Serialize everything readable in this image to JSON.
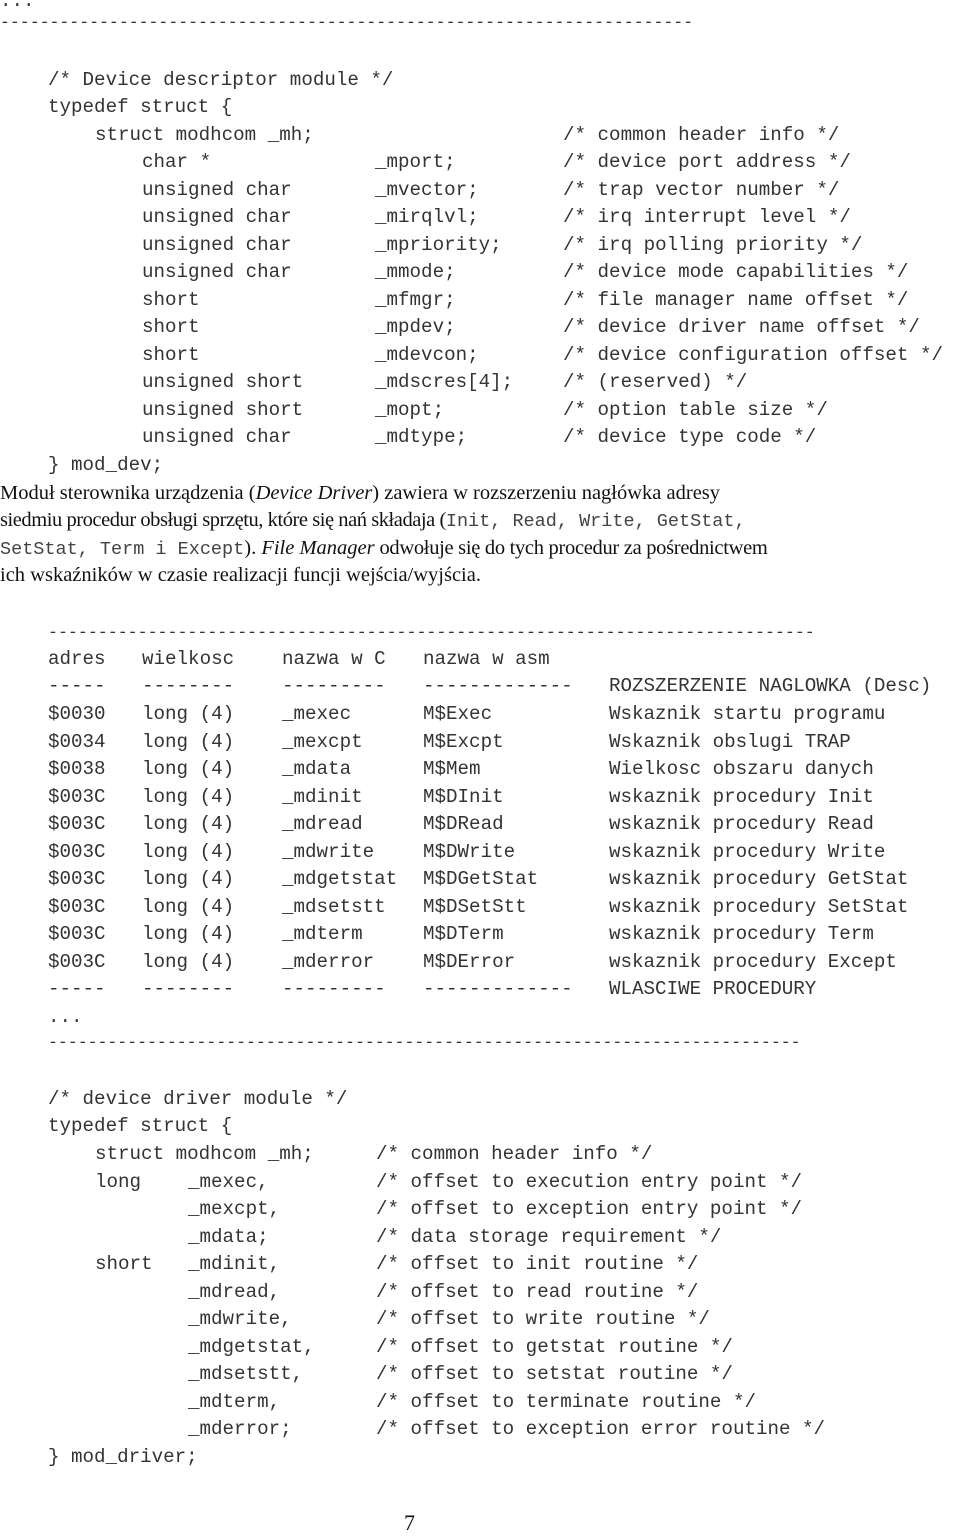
{
  "top": {
    "ellipsis": "...",
    "rule": "----------------------------------------------------------------------"
  },
  "struct1": {
    "comment": "/* Device descriptor module */",
    "open": "typedef struct {",
    "header": {
      "decl": "struct modhcom _mh;",
      "comment": "/* common header info */"
    },
    "fields": [
      {
        "type": "char *",
        "name": "_mport;",
        "comment": "/* device port address */"
      },
      {
        "type": "unsigned char",
        "name": "_mvector;",
        "comment": "/* trap vector number */"
      },
      {
        "type": "unsigned char",
        "name": "_mirqlvl;",
        "comment": "/* irq interrupt level */"
      },
      {
        "type": "unsigned char",
        "name": "_mpriority;",
        "comment": "/* irq polling priority */"
      },
      {
        "type": "unsigned char",
        "name": "_mmode;",
        "comment": "/* device mode capabilities */"
      },
      {
        "type": "short",
        "name": "_mfmgr;",
        "comment": "/* file manager name offset */"
      },
      {
        "type": "short",
        "name": "_mpdev;",
        "comment": "/* device driver name offset */"
      },
      {
        "type": "short",
        "name": "_mdevcon;",
        "comment": "/* device configuration offset */"
      },
      {
        "type": "unsigned short",
        "name": "_mdscres[4];",
        "comment": "/* (reserved) */"
      },
      {
        "type": "unsigned short",
        "name": "_mopt;",
        "comment": "/* option table size */"
      },
      {
        "type": "unsigned char",
        "name": "_mdtype;",
        "comment": "/* device type code */"
      }
    ],
    "close": "} mod_dev;"
  },
  "paragraph": {
    "l1_a": "Moduł sterownika urządzenia (",
    "l1_i": "Device Driver",
    "l1_b": ") zawiera w rozszerzeniu nagłówka adresy",
    "l2_a": "siedmiu procedur obsługi sprzętu, które się nań składaja (",
    "l2_m": "Init, Read, Write, GetStat,",
    "l3_m": "SetStat, Term i Except",
    "l3_b": "). ",
    "l3_i": "File Manager",
    "l3_c": " odwołuje się do tych procedur za pośrednictwem",
    "l4": "ich wskaźników w czasie realizacji funcji wejścia/wyjścia."
  },
  "table": {
    "rule_top": "-----------------------------------------------------------------------------",
    "headers": [
      "adres",
      "wielkosc",
      "nazwa w C",
      "nazwa w asm"
    ],
    "dashes": [
      "-----",
      "--------",
      "---------",
      "-------------"
    ],
    "section_start": "ROZSZERZENIE NAGLOWKA (Desc)",
    "rows": [
      [
        "$0030",
        "long (4)",
        "_mexec",
        "M$Exec",
        "Wskaznik startu programu"
      ],
      [
        "$0034",
        "long (4)",
        "_mexcpt",
        "M$Excpt",
        "Wskaznik obslugi TRAP"
      ],
      [
        "$0038",
        "long (4)",
        "_mdata",
        "M$Mem",
        "Wielkosc obszaru danych"
      ],
      [
        "$003C",
        "long (4)",
        "_mdinit",
        "M$DInit",
        "wskaznik procedury Init"
      ],
      [
        "$003C",
        "long (4)",
        "_mdread",
        "M$DRead",
        "wskaznik procedury Read"
      ],
      [
        "$003C",
        "long (4)",
        "_mdwrite",
        "M$DWrite",
        "wskaznik procedury Write"
      ],
      [
        "$003C",
        "long (4)",
        "_mdgetstat",
        "M$DGetStat",
        "wskaznik procedury GetStat"
      ],
      [
        "$003C",
        "long (4)",
        "_mdsetstt",
        "M$DSetStt",
        "wskaznik procedury SetStat"
      ],
      [
        "$003C",
        "long (4)",
        "_mdterm",
        "M$DTerm",
        "wskaznik procedury Term"
      ],
      [
        "$003C",
        "long (4)",
        "_mderror",
        "M$DError",
        "wskaznik procedury Except"
      ]
    ],
    "section_end": "WLASCIWE PROCEDURY",
    "ellipsis": "...",
    "rule_bottom": "----------------------------------------------------------------------------"
  },
  "struct2": {
    "comment": "/* device driver module */",
    "open": "typedef struct {",
    "rows": [
      {
        "type": "struct modhcom _mh;",
        "name": "",
        "comment": "/* common header info */"
      },
      {
        "type": "long",
        "name": "_mexec,",
        "comment": "/* offset to execution entry point */"
      },
      {
        "type": "",
        "name": "_mexcpt,",
        "comment": "/* offset to exception entry point */"
      },
      {
        "type": "",
        "name": "_mdata;",
        "comment": "/* data storage requirement */"
      },
      {
        "type": "short",
        "name": "_mdinit,",
        "comment": "/* offset to init routine */"
      },
      {
        "type": "",
        "name": "_mdread,",
        "comment": "/* offset to read routine */"
      },
      {
        "type": "",
        "name": "_mdwrite,",
        "comment": "/* offset to write routine */"
      },
      {
        "type": "",
        "name": "_mdgetstat,",
        "comment": "/* offset to getstat routine */"
      },
      {
        "type": "",
        "name": "_mdsetstt,",
        "comment": "/* offset to setstat routine */"
      },
      {
        "type": "",
        "name": "_mdterm,",
        "comment": "/* offset to terminate routine */"
      },
      {
        "type": "",
        "name": "_mderror;",
        "comment": "/* offset to exception error routine */"
      }
    ],
    "close": "} mod_driver;"
  },
  "page_number": "7"
}
